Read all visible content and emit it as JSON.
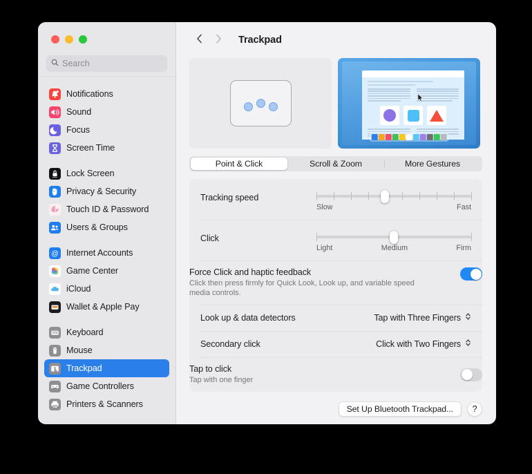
{
  "window": {
    "traffic_lights": [
      "close",
      "minimize",
      "zoom"
    ],
    "colors": {
      "close": "#fc5f57",
      "minimize": "#fdbc2e",
      "zoom": "#29c83f",
      "accent": "#2b7fe8",
      "toggle_on": "#1f8af5"
    }
  },
  "sidebar": {
    "search": {
      "placeholder": "Search",
      "value": "",
      "icon": "search-icon"
    },
    "groups": [
      {
        "items": [
          {
            "label": "Notifications",
            "icon": "notifications-icon"
          },
          {
            "label": "Sound",
            "icon": "sound-icon"
          },
          {
            "label": "Focus",
            "icon": "focus-icon"
          },
          {
            "label": "Screen Time",
            "icon": "screen-time-icon"
          }
        ]
      },
      {
        "items": [
          {
            "label": "Lock Screen",
            "icon": "lock-screen-icon"
          },
          {
            "label": "Privacy & Security",
            "icon": "privacy-security-icon"
          },
          {
            "label": "Touch ID & Password",
            "icon": "touch-id-icon"
          },
          {
            "label": "Users & Groups",
            "icon": "users-groups-icon"
          }
        ]
      },
      {
        "items": [
          {
            "label": "Internet Accounts",
            "icon": "internet-accounts-icon"
          },
          {
            "label": "Game Center",
            "icon": "game-center-icon"
          },
          {
            "label": "iCloud",
            "icon": "icloud-icon"
          },
          {
            "label": "Wallet & Apple Pay",
            "icon": "wallet-icon"
          }
        ]
      },
      {
        "items": [
          {
            "label": "Keyboard",
            "icon": "keyboard-icon"
          },
          {
            "label": "Mouse",
            "icon": "mouse-icon"
          },
          {
            "label": "Trackpad",
            "icon": "trackpad-icon",
            "selected": true
          },
          {
            "label": "Game Controllers",
            "icon": "game-controllers-icon"
          },
          {
            "label": "Printers & Scanners",
            "icon": "printers-scanners-icon"
          }
        ]
      }
    ]
  },
  "toolbar": {
    "back_icon": "chevron-left-icon",
    "forward_icon": "chevron-right-icon",
    "title": "Trackpad"
  },
  "previews": {
    "left": {
      "name": "trackpad-gesture-preview",
      "finger_dots": 3
    },
    "right": {
      "name": "desktop-animation-preview",
      "dock_colors": [
        "#2a7fe8",
        "#f5a623",
        "#f4506a",
        "#43bf5a",
        "#f7c81e",
        "#ffffff",
        "#5ac8f5",
        "#9a82e8",
        "#6e6e73",
        "#35c759",
        "#b8b8bd"
      ]
    }
  },
  "tabs": [
    {
      "label": "Point & Click",
      "active": true
    },
    {
      "label": "Scroll & Zoom",
      "active": false
    },
    {
      "label": "More Gestures",
      "active": false
    }
  ],
  "settings": {
    "tracking_speed": {
      "label": "Tracking speed",
      "min_label": "Slow",
      "max_label": "Fast",
      "ticks": 10,
      "value_index": 4
    },
    "click": {
      "label": "Click",
      "min_label": "Light",
      "mid_label": "Medium",
      "max_label": "Firm",
      "ticks": 3,
      "value_index": 1
    },
    "force_click": {
      "label": "Force Click and haptic feedback",
      "description": "Click then press firmly for Quick Look, Look up, and variable speed media controls.",
      "enabled": true
    },
    "look_up": {
      "label": "Look up & data detectors",
      "value": "Tap with Three Fingers"
    },
    "secondary_click": {
      "label": "Secondary click",
      "value": "Click with Two Fingers"
    },
    "tap_to_click": {
      "label": "Tap to click",
      "description": "Tap with one finger",
      "enabled": false
    }
  },
  "footer": {
    "setup_button": "Set Up Bluetooth Trackpad...",
    "help_button": "?"
  }
}
